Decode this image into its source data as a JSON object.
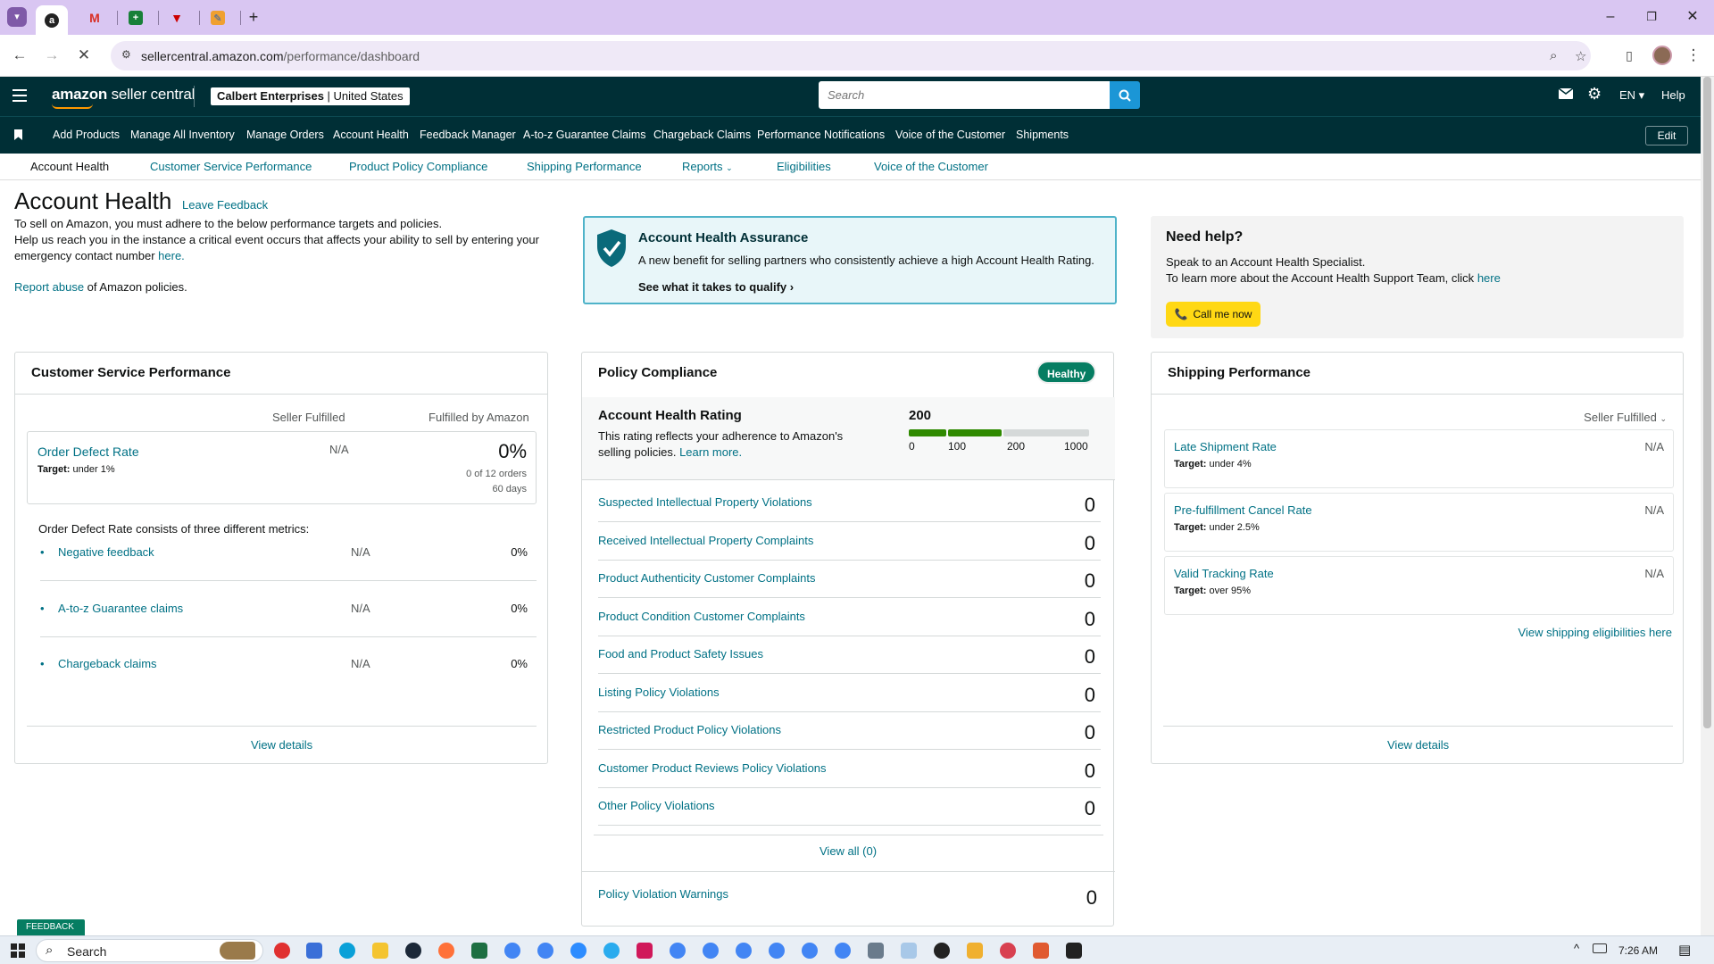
{
  "browser": {
    "url_domain": "sellercentral.amazon.com",
    "url_path": "/performance/dashboard"
  },
  "header": {
    "logo_bold": "amazon",
    "logo_rest": " seller central",
    "account_name": "Calbert Enterprises",
    "account_region": "United States",
    "search_placeholder": "Search",
    "language": "EN",
    "help_label": "Help"
  },
  "nav": {
    "items": [
      "Add Products",
      "Manage All Inventory",
      "Manage Orders",
      "Account Health",
      "Feedback Manager",
      "A-to-z Guarantee Claims",
      "Chargeback Claims",
      "Performance Notifications",
      "Voice of the Customer",
      "Shipments"
    ],
    "edit_label": "Edit"
  },
  "subnav": {
    "items": [
      "Account Health",
      "Customer Service Performance",
      "Product Policy Compliance",
      "Shipping Performance",
      "Reports",
      "Eligibilities",
      "Voice of the Customer"
    ]
  },
  "page": {
    "title": "Account Health",
    "leave_feedback": "Leave Feedback",
    "intro_line1": "To sell on Amazon, you must adhere to the below performance targets and policies.",
    "intro_line2": "Help us reach you in the instance a critical event occurs that affects your ability to sell by entering your emergency contact number",
    "intro_here": "here.",
    "report_link": "Report abuse",
    "report_rest": " of Amazon policies."
  },
  "assurance": {
    "title": "Account Health Assurance",
    "desc": "A new benefit for selling partners who consistently achieve a high Account Health Rating.",
    "qualify": "See what it takes to qualify"
  },
  "help": {
    "title": "Need help?",
    "line1": "Speak to an Account Health Specialist.",
    "line2": "To learn more about the Account Health Support Team, click",
    "here": "here",
    "call_label": "Call me now"
  },
  "csp": {
    "title": "Customer Service Performance",
    "col_seller": "Seller Fulfilled",
    "col_fba": "Fulfilled by Amazon",
    "odr_label": "Order Defect Rate",
    "odr_target_label": "Target:",
    "odr_target": "under 1%",
    "odr_seller": "N/A",
    "odr_fba": "0%",
    "odr_orders": "0 of 12 orders",
    "odr_days": "60 days",
    "metrics_intro": "Order Defect Rate consists of three different metrics:",
    "metrics": [
      {
        "label": "Negative feedback",
        "seller": "N/A",
        "fba": "0%"
      },
      {
        "label": "A-to-z Guarantee claims",
        "seller": "N/A",
        "fba": "0%"
      },
      {
        "label": "Chargeback claims",
        "seller": "N/A",
        "fba": "0%"
      }
    ],
    "view_details": "View details"
  },
  "policy": {
    "title": "Policy Compliance",
    "status": "Healthy",
    "ahr_title": "Account Health Rating",
    "ahr_desc1": "This rating reflects your adherence to Amazon's",
    "ahr_desc2": "selling policies.",
    "learn_more": "Learn more.",
    "rating": "200",
    "rating_value": 200,
    "scale": [
      "0",
      "100",
      "200",
      "1000"
    ],
    "violations": [
      {
        "label": "Suspected Intellectual Property Violations",
        "count": "0"
      },
      {
        "label": "Received Intellectual Property Complaints",
        "count": "0"
      },
      {
        "label": "Product Authenticity Customer Complaints",
        "count": "0"
      },
      {
        "label": "Product Condition Customer Complaints",
        "count": "0"
      },
      {
        "label": "Food and Product Safety Issues",
        "count": "0"
      },
      {
        "label": "Listing Policy Violations",
        "count": "0"
      },
      {
        "label": "Restricted Product Policy Violations",
        "count": "0"
      },
      {
        "label": "Customer Product Reviews Policy Violations",
        "count": "0"
      },
      {
        "label": "Other Policy Violations",
        "count": "0"
      }
    ],
    "view_all": "View all (0)",
    "warnings_label": "Policy Violation Warnings",
    "warnings_count": "0"
  },
  "shipping": {
    "title": "Shipping Performance",
    "filter": "Seller Fulfilled",
    "rows": [
      {
        "label": "Late Shipment Rate",
        "target_label": "Target:",
        "target": "under 4%",
        "value": "N/A"
      },
      {
        "label": "Pre-fulfillment Cancel Rate",
        "target_label": "Target:",
        "target": "under 2.5%",
        "value": "N/A"
      },
      {
        "label": "Valid Tracking Rate",
        "target_label": "Target:",
        "target": "over 95%",
        "value": "N/A"
      }
    ],
    "eligibilities_link": "View shipping eligibilities here",
    "view_details": "View details"
  },
  "feedback_tag": "FEEDBACK",
  "taskbar": {
    "search_placeholder": "Search",
    "time": "7:26 AM"
  },
  "colors": {
    "amazon_header": "#002f36",
    "link": "#007185",
    "healthy_green": "#067d62",
    "rating_green": "#2f8a00",
    "call_yellow": "#ffd814",
    "search_blue": "#1b96d6"
  }
}
